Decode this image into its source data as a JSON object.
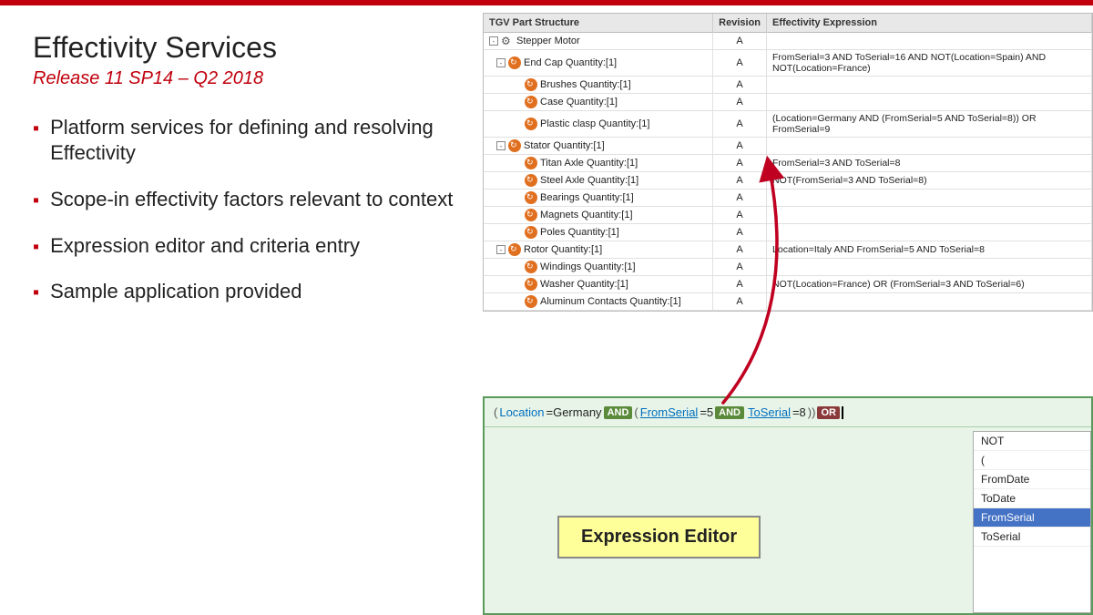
{
  "topBar": {},
  "leftPanel": {
    "title": "Effectivity Services",
    "subtitle": "Release 11 SP14 – Q2 2018",
    "bullets": [
      "Platform services for defining and resolving Effectivity",
      "Scope-in effectivity factors relevant to context",
      "Expression editor and criteria entry",
      "Sample application provided"
    ]
  },
  "rightPanel": {
    "table": {
      "headers": [
        "TGV Part Structure",
        "Revision",
        "Effectivity Expression"
      ],
      "rows": [
        {
          "level": 0,
          "type": "gear",
          "expand": true,
          "name": "Stepper Motor",
          "rev": "A",
          "expr": ""
        },
        {
          "level": 1,
          "type": "icon",
          "expand": true,
          "name": "End Cap Quantity:[1]",
          "rev": "A",
          "expr": "FromSerial=3 AND ToSerial=16 AND NOT(Location=Spain) AND NOT(Location=France)"
        },
        {
          "level": 2,
          "type": "icon",
          "expand": false,
          "name": "Brushes Quantity:[1]",
          "rev": "A",
          "expr": ""
        },
        {
          "level": 2,
          "type": "icon",
          "expand": false,
          "name": "Case Quantity:[1]",
          "rev": "A",
          "expr": ""
        },
        {
          "level": 2,
          "type": "icon",
          "expand": false,
          "name": "Plastic clasp Quantity:[1]",
          "rev": "A",
          "expr": "(Location=Germany AND (FromSerial=5 AND ToSerial=8)) OR FromSerial=9"
        },
        {
          "level": 1,
          "type": "icon",
          "expand": true,
          "name": "Stator Quantity:[1]",
          "rev": "A",
          "expr": ""
        },
        {
          "level": 2,
          "type": "icon",
          "expand": false,
          "name": "Titan Axle Quantity:[1]",
          "rev": "A",
          "expr": "FromSerial=3 AND ToSerial=8"
        },
        {
          "level": 2,
          "type": "icon",
          "expand": false,
          "name": "Steel Axle Quantity:[1]",
          "rev": "A",
          "expr": "NOT(FromSerial=3 AND ToSerial=8)"
        },
        {
          "level": 2,
          "type": "icon",
          "expand": false,
          "name": "Bearings Quantity:[1]",
          "rev": "A",
          "expr": ""
        },
        {
          "level": 2,
          "type": "icon",
          "expand": false,
          "name": "Magnets Quantity:[1]",
          "rev": "A",
          "expr": ""
        },
        {
          "level": 2,
          "type": "icon",
          "expand": false,
          "name": "Poles Quantity:[1]",
          "rev": "A",
          "expr": ""
        },
        {
          "level": 1,
          "type": "icon",
          "expand": true,
          "name": "Rotor Quantity:[1]",
          "rev": "A",
          "expr": "Location=Italy AND FromSerial=5 AND ToSerial=8"
        },
        {
          "level": 2,
          "type": "icon",
          "expand": false,
          "name": "Windings Quantity:[1]",
          "rev": "A",
          "expr": ""
        },
        {
          "level": 2,
          "type": "icon",
          "expand": false,
          "name": "Washer Quantity:[1]",
          "rev": "A",
          "expr": "NOT(Location=France) OR (FromSerial=3 AND ToSerial=6)"
        },
        {
          "level": 2,
          "type": "icon",
          "expand": false,
          "name": "Aluminum Contacts Quantity:[1]",
          "rev": "A",
          "expr": ""
        }
      ]
    },
    "expressionBar": {
      "tokens": [
        {
          "text": "(",
          "type": "paren"
        },
        {
          "text": "Location",
          "type": "value-expr"
        },
        {
          "text": "=Germany ",
          "type": "expr"
        },
        {
          "text": "AND",
          "type": "keyword"
        },
        {
          "text": " (",
          "type": "paren"
        },
        {
          "text": "FromSerial",
          "type": "value-expr underline"
        },
        {
          "text": "=5 ",
          "type": "expr"
        },
        {
          "text": "AND",
          "type": "keyword"
        },
        {
          "text": " ",
          "type": "expr"
        },
        {
          "text": "ToSerial",
          "type": "value-expr underline"
        },
        {
          "text": "=8",
          "type": "expr"
        },
        {
          "text": "))",
          "type": "paren"
        },
        {
          "text": " ",
          "type": "expr"
        },
        {
          "text": "OR",
          "type": "keyword or"
        },
        {
          "text": " |",
          "type": "cursor"
        }
      ]
    },
    "dropdown": {
      "items": [
        "NOT",
        "(",
        "FromDate",
        "ToDate",
        "FromSerial",
        "ToSerial"
      ],
      "selectedIndex": 4
    },
    "expressionEditorLabel": "Expression Editor"
  }
}
